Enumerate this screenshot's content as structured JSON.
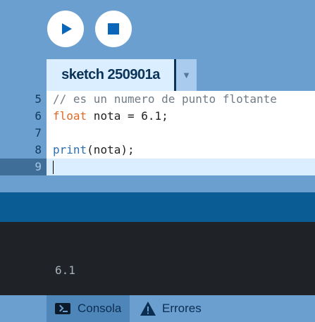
{
  "toolbar": {
    "run_icon": "play-icon",
    "stop_icon": "stop-icon"
  },
  "tabs": {
    "sketch_name": "sketch 250901a",
    "menu_glyph": "▼"
  },
  "editor": {
    "lines": [
      {
        "number": "5",
        "tokens": [
          {
            "text": "// es un numero de punto flotante",
            "kind": "comment"
          }
        ]
      },
      {
        "number": "6",
        "tokens": [
          {
            "text": "float",
            "kind": "type"
          },
          {
            "text": " nota = 6.1;",
            "kind": "plain"
          }
        ]
      },
      {
        "number": "7",
        "tokens": []
      },
      {
        "number": "8",
        "tokens": [
          {
            "text": "print",
            "kind": "fn"
          },
          {
            "text": "(nota);",
            "kind": "plain"
          }
        ]
      },
      {
        "number": "9",
        "tokens": [],
        "active": true
      }
    ]
  },
  "console": {
    "output": "6.1"
  },
  "bottom_tabs": {
    "console_label": "Consola",
    "errors_label": "Errores"
  },
  "colors": {
    "background": "#6a9fd0",
    "accent": "#0a66b8",
    "keyword": "#e16a26",
    "function": "#2a6fb0",
    "comment": "#6f7b86",
    "console_bg": "#1f2328"
  }
}
